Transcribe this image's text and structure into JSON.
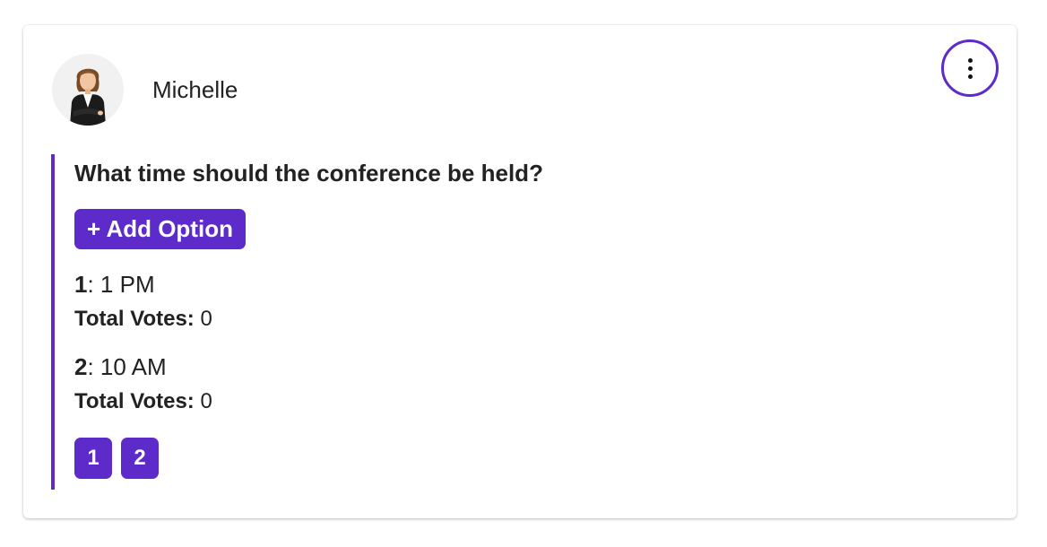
{
  "user": {
    "name": "Michelle",
    "avatar_icon": "businesswoman-avatar-icon"
  },
  "menu": {
    "icon": "more-vertical-icon"
  },
  "poll": {
    "question": "What time should the conference be held?",
    "add_option_label": "+ Add Option",
    "votes_label": "Total Votes:",
    "options": [
      {
        "number": "1",
        "text": ": 1 PM",
        "votes": " 0"
      },
      {
        "number": "2",
        "text": ": 10 AM",
        "votes": " 0"
      }
    ],
    "pages": [
      "1",
      "2"
    ]
  },
  "colors": {
    "accent": "#5c2bc9"
  }
}
